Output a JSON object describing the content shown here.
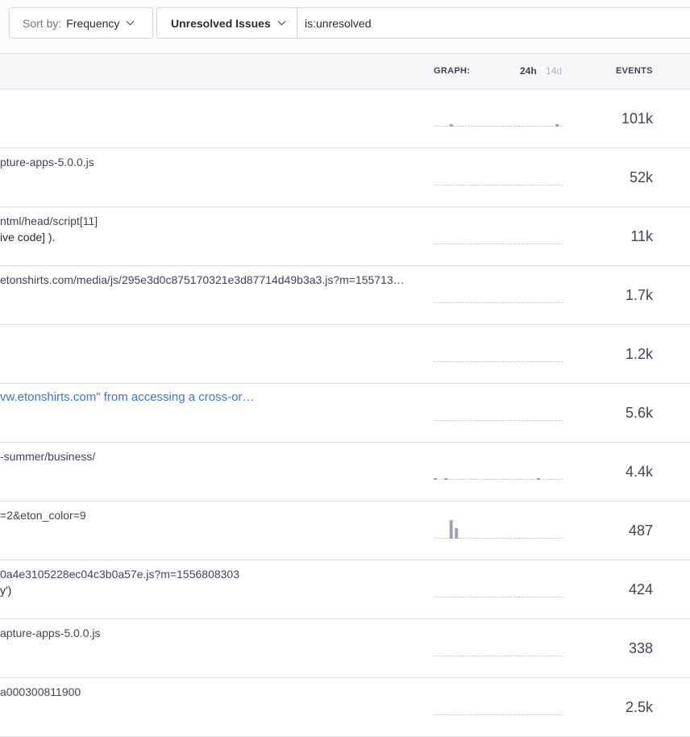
{
  "toolbar": {
    "sort_prefix": "Sort by:",
    "sort_value": "Frequency",
    "query_label": "Unresolved Issues",
    "search_value": "is:unresolved"
  },
  "table_header": {
    "graph_label": "GRAPH:",
    "period_24h": "24h",
    "period_14d": "14d",
    "events_label": "EVENTS"
  },
  "colors": {
    "bar": "#a69bbd",
    "baseline": "#c9c3d1",
    "link": "#3d74db"
  },
  "rows": [
    {
      "line1": "",
      "line2": "",
      "is_link": false,
      "count": "101k",
      "bars": [
        {
          "i": 6,
          "h": 2
        },
        {
          "i": 46,
          "h": 2
        }
      ]
    },
    {
      "line1": "pture-apps-5.0.0.js",
      "line2": "",
      "is_link": false,
      "count": "52k",
      "bars": []
    },
    {
      "line1": "ntml/head/script[11]",
      "line2": "ive code] ).",
      "is_link": false,
      "count": "11k",
      "bars": []
    },
    {
      "line1": "etonshirts.com/media/js/295e3d0c875170321e3d87714d49b3a3.js?m=155713…",
      "line2": "",
      "is_link": false,
      "count": "1.7k",
      "bars": []
    },
    {
      "line1": "",
      "line2": "",
      "is_link": false,
      "count": "1.2k",
      "bars": []
    },
    {
      "line1": "vw.etonshirts.com\" from accessing a cross-or…",
      "line2": "",
      "is_link": true,
      "count": "5.6k",
      "bars": []
    },
    {
      "line1": "-summer/business/",
      "line2": "",
      "is_link": false,
      "count": "4.4k",
      "bars": [
        {
          "i": 0,
          "h": 1
        },
        {
          "i": 4,
          "h": 1
        },
        {
          "i": 39,
          "h": 1
        }
      ]
    },
    {
      "line1": "=2&eton_color=9",
      "line2": "",
      "is_link": false,
      "count": "487",
      "bars": [
        {
          "i": 6,
          "h": 22
        },
        {
          "i": 8,
          "h": 12
        }
      ]
    },
    {
      "line1": "0a4e3105228ec04c3b0a57e.js?m=1556808303",
      "line2": "y')",
      "is_link": false,
      "count": "424",
      "bars": []
    },
    {
      "line1": "apture-apps-5.0.0.js",
      "line2": "",
      "is_link": false,
      "count": "338",
      "bars": []
    },
    {
      "line1": "a000300811900",
      "line2": "",
      "is_link": false,
      "count": "2.5k",
      "bars": []
    }
  ]
}
